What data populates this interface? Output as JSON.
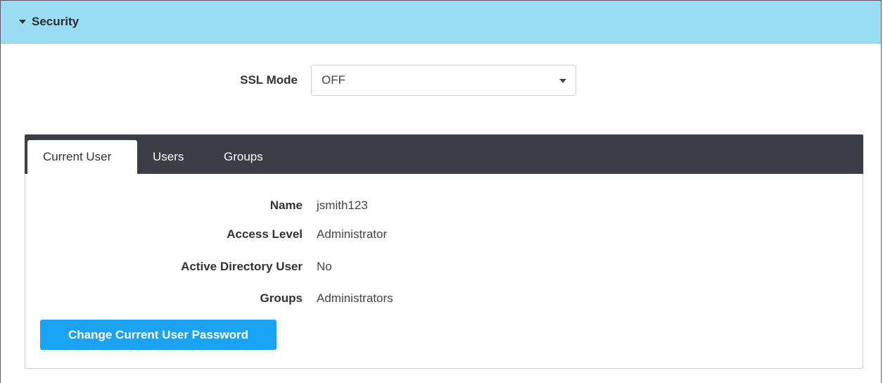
{
  "section": {
    "title": "Security",
    "expand_icon": "caret-down-icon"
  },
  "ssl": {
    "label": "SSL Mode",
    "selected_value": "OFF",
    "dropdown_icon": "caret-down-icon"
  },
  "tabs": [
    {
      "label": "Current User",
      "active": true
    },
    {
      "label": "Users",
      "active": false
    },
    {
      "label": "Groups",
      "active": false
    }
  ],
  "current_user": {
    "fields": [
      {
        "label": "Name",
        "value": "jsmith123"
      },
      {
        "label": "Access Level",
        "value": "Administrator"
      },
      {
        "label": "Active Directory User",
        "value": "No"
      },
      {
        "label": "Groups",
        "value": "Administrators"
      }
    ],
    "change_password_label": "Change Current User Password"
  },
  "colors": {
    "header_bg": "#9adcf2",
    "tabbar_bg": "#3b3e44",
    "primary_button": "#1aa3f4"
  }
}
